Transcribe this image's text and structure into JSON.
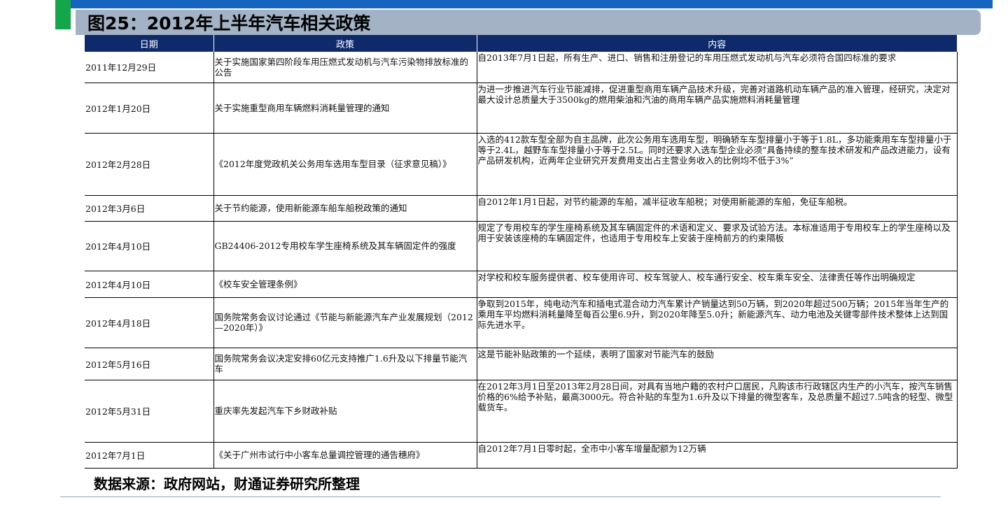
{
  "title": "图25：2012年上半年汽车相关政策",
  "table": {
    "headers": [
      "日期",
      "政策",
      "内容"
    ],
    "rows": [
      {
        "date": "2011年12月29日",
        "policy": "关于实施国家第四阶段车用压燃式发动机与汽车污染物排放标准的公告",
        "content": "自2013年7月1日起，所有生产、进口、销售和注册登记的车用压燃式发动机与汽车必须符合国四标准的要求"
      },
      {
        "date": "2012年1月20日",
        "policy": "关于实施重型商用车辆燃料消耗量管理的通知",
        "content": "为进一步推进汽车行业节能减排，促进重型商用车辆产品技术升级，完善对道路机动车辆产品的准入管理，经研究，决定对最大设计总质量大于3500kg的燃用柴油和汽油的商用车辆产品实施燃料消耗量管理"
      },
      {
        "date": "2012年2月28日",
        "policy": "《2012年度党政机关公务用车选用车型目录（征求意见稿）》",
        "content": "入选的412款车型全部为自主品牌，此次公务用车选用车型，明确轿车车型排量小于等于1.8L，多功能乘用车车型排量小于等于2.4L，越野车车型排量小于等于2.5L。同时还要求入选车型企业必须“具备持续的整车技术研发和产品改进能力，设有产品研发机构，近两年企业研究开发费用支出占主营业务收入的比例均不低于3%”"
      },
      {
        "date": "2012年3月6日",
        "policy": "关于节约能源，使用新能源车船车船税政策的通知",
        "content": "自2012年1月1日起，对节约能源的车船，减半征收车船税；对使用新能源的车船，免征车船税。"
      },
      {
        "date": "2012年4月10日",
        "policy": "GB24406-2012专用校车学生座椅系统及其车辆固定件的强度",
        "content": "规定了专用校车的学生座椅系统及其车辆固定件的术语和定义、要求及试验方法。本标准适用于专用校车上的学生座椅以及用于安装该座椅的车辆固定件，也适用于专用校车上安装于座椅前方的约束隔板"
      },
      {
        "date": "2012年4月10日",
        "policy": "《校车安全管理条例》",
        "content": "对学校和校车服务提供者、校车使用许可、校车驾驶人、校车通行安全、校车乘车安全、法律责任等作出明确规定"
      },
      {
        "date": "2012年4月18日",
        "policy": "国务院常务会议讨论通过《节能与新能源汽车产业发展规划（2012—2020年）》",
        "content": "争取到2015年，纯电动汽车和插电式混合动力汽车累计产销量达到50万辆，到2020年超过500万辆；2015年当年生产的乘用车平均燃料消耗量降至每百公里6.9升，到2020年降至5.0升；新能源汽车、动力电池及关键零部件技术整体上达到国际先进水平。"
      },
      {
        "date": "2012年5月16日",
        "policy": "国务院常务会议决定安排60亿元支持推广1.6升及以下排量节能汽车",
        "content": "这是节能补贴政策的一个延续，表明了国家对节能汽车的鼓励"
      },
      {
        "date": "2012年5月31日",
        "policy": "重庆率先发起汽车下乡财政补贴",
        "content": "在2012年3月1日至2013年2月28日间，对具有当地户籍的农村户口居民，凡购该市行政辖区内生产的小汽车，按汽车销售价格的6%给予补贴，最高3000元。符合补贴的车型为1.6升及以下排量的微型客车，及总质量不超过7.5吨含的轻型、微型载货车。"
      },
      {
        "date": "2012年7月1日",
        "policy": "《关于广州市试行中小客车总量调控管理的通告穗府》",
        "content": "自2012年7月1日零时起，全市中小客车增量配额为12万辆"
      }
    ]
  },
  "source": "数据来源：政府网站，财通证券研究所整理"
}
